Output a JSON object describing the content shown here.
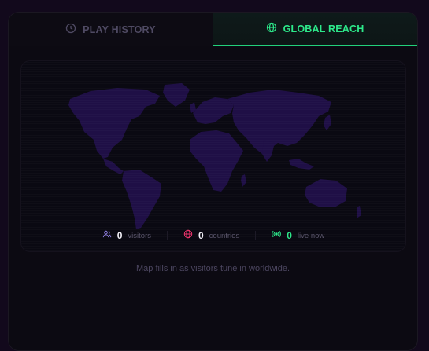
{
  "tabs": {
    "history": {
      "label": "PLAY HISTORY",
      "icon": "clock-icon"
    },
    "global": {
      "label": "GLOBAL REACH",
      "icon": "globe-icon"
    }
  },
  "stats": {
    "visitors": {
      "value": "0",
      "label": "visitors",
      "icon": "users-icon"
    },
    "countries": {
      "value": "0",
      "label": "countries",
      "icon": "globe-icon"
    },
    "live": {
      "value": "0",
      "label": "live now",
      "icon": "broadcast-icon"
    }
  },
  "caption": "Map fills in as visitors tune in worldwide.",
  "colors": {
    "accent": "#22d17b",
    "visitors_icon": "#8b7bd8",
    "countries_icon": "#e8336a",
    "live_icon": "#2de88a",
    "map_land": "#1f0f46"
  }
}
